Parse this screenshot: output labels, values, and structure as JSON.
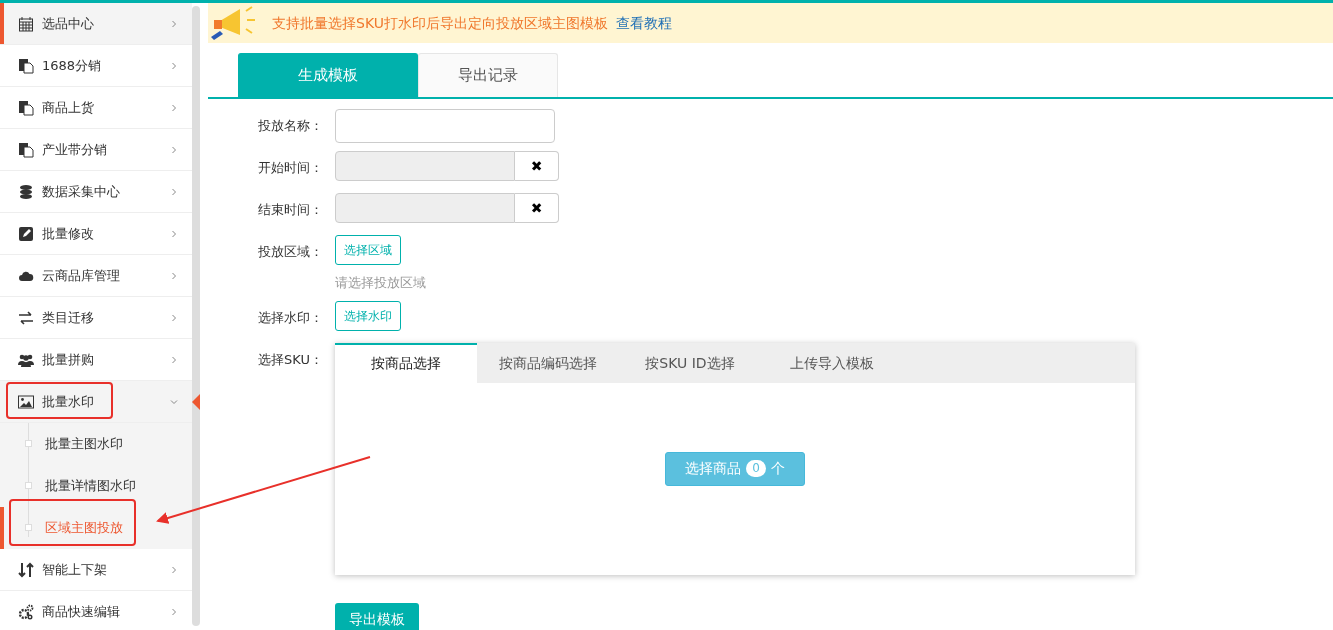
{
  "sidebar": {
    "items": [
      {
        "label": "选品中心",
        "selected": true,
        "expanded": false
      },
      {
        "label": "1688分销",
        "selected": false,
        "expanded": false
      },
      {
        "label": "商品上货",
        "selected": false,
        "expanded": false
      },
      {
        "label": "产业带分销",
        "selected": false,
        "expanded": false
      },
      {
        "label": "数据采集中心",
        "selected": false,
        "expanded": false
      },
      {
        "label": "批量修改",
        "selected": false,
        "expanded": false
      },
      {
        "label": "云商品库管理",
        "selected": false,
        "expanded": false
      },
      {
        "label": "类目迁移",
        "selected": false,
        "expanded": false
      },
      {
        "label": "批量拼购",
        "selected": false,
        "expanded": false
      },
      {
        "label": "批量水印",
        "selected": false,
        "expanded": true,
        "children": [
          {
            "label": "批量主图水印",
            "selected": false
          },
          {
            "label": "批量详情图水印",
            "selected": false
          },
          {
            "label": "区域主图投放",
            "selected": true
          }
        ]
      },
      {
        "label": "智能上下架",
        "selected": false,
        "expanded": false
      },
      {
        "label": "商品快速编辑",
        "selected": false,
        "expanded": false
      }
    ]
  },
  "notice": {
    "text": "支持批量选择SKU打水印后导出定向投放区域主图模板",
    "link": "查看教程"
  },
  "tabs": [
    {
      "label": "生成模板",
      "selected": true
    },
    {
      "label": "导出记录",
      "selected": false
    }
  ],
  "form": {
    "rows": [
      {
        "kind": "text",
        "label": "投放名称："
      },
      {
        "kind": "date",
        "label": "开始时间：",
        "clear": "✖"
      },
      {
        "kind": "date",
        "label": "结束时间：",
        "clear": "✖"
      },
      {
        "kind": "button",
        "label": "投放区域：",
        "button": "选择区域",
        "help": "请选择投放区域"
      },
      {
        "kind": "button",
        "label": "选择水印：",
        "button": "选择水印"
      },
      {
        "kind": "sku",
        "label": "选择SKU："
      }
    ]
  },
  "sku_panel": {
    "tabs": [
      {
        "label": "按商品选择",
        "selected": true
      },
      {
        "label": "按商品编码选择",
        "selected": false
      },
      {
        "label": "按SKU ID选择",
        "selected": false
      },
      {
        "label": "上传导入模板",
        "selected": false
      }
    ],
    "select_button": {
      "label": "选择商品",
      "count": "0",
      "unit": "个"
    }
  },
  "export_button": "导出模板"
}
